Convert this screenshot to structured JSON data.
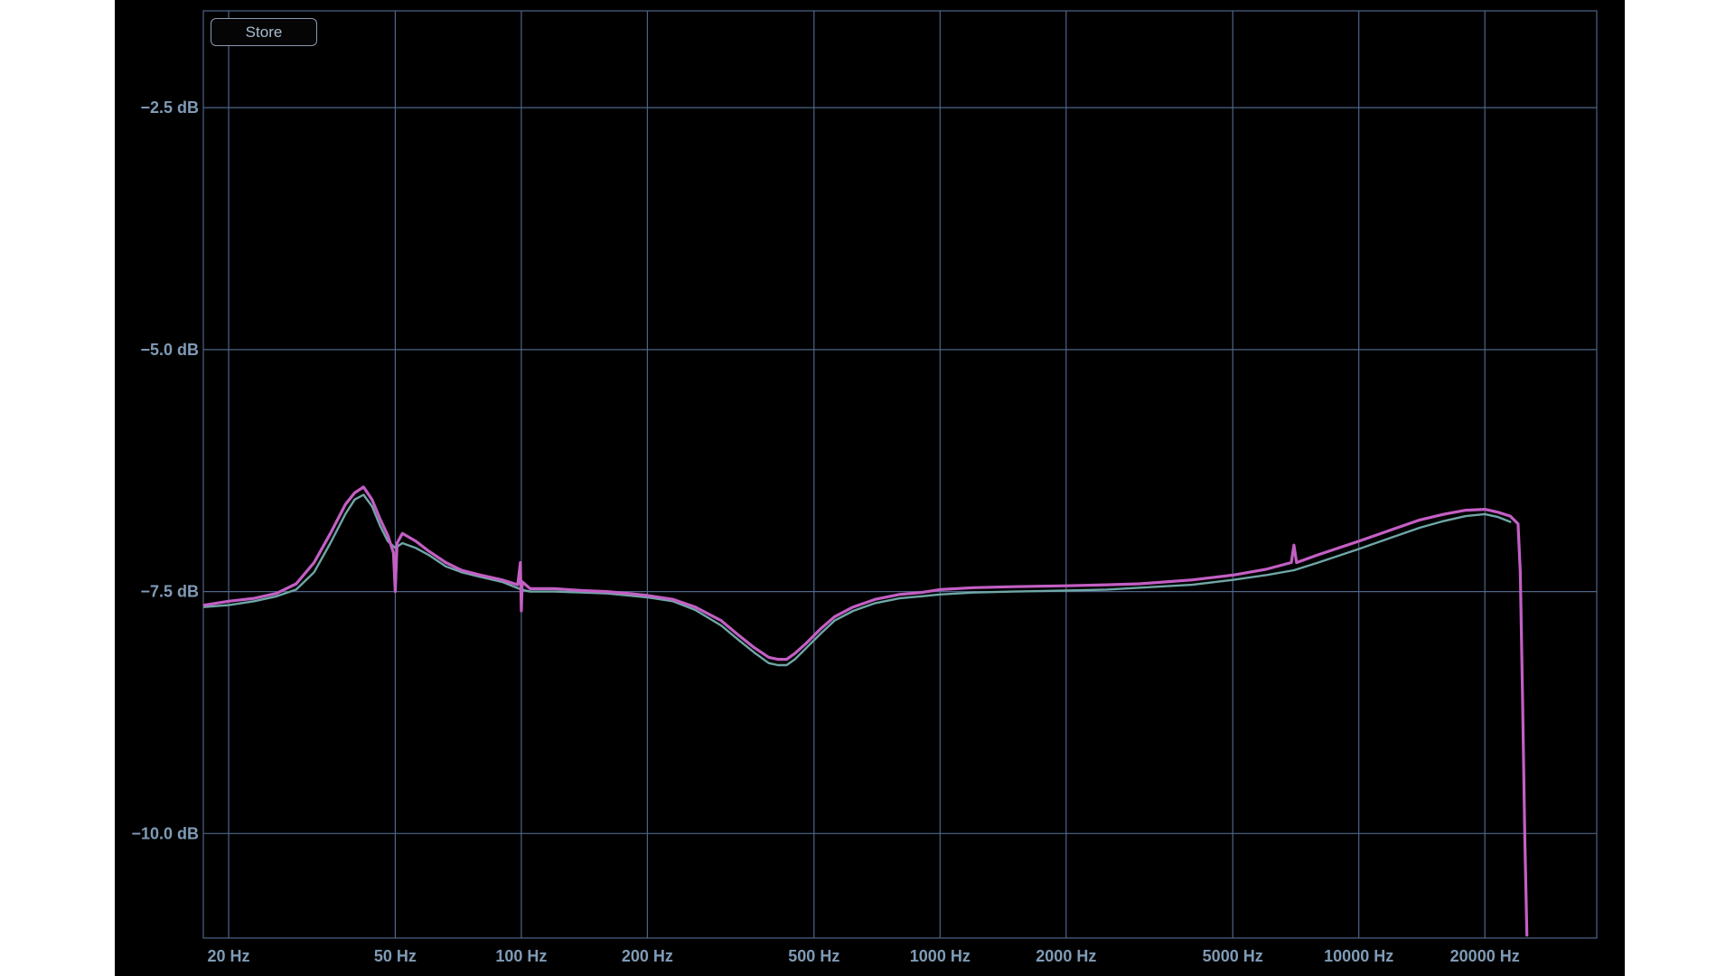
{
  "ui": {
    "store_label": "Store"
  },
  "colors": {
    "background": "#000000",
    "grid": "#4e6588",
    "tick_text": "#7f9bb6",
    "series_a": "#c35fc4",
    "series_b": "#6fa6a6"
  },
  "chart_data": {
    "type": "line",
    "title": "",
    "xlabel": "",
    "ylabel": "",
    "x_scale": "log",
    "x_ticks": [
      20,
      50,
      100,
      200,
      500,
      1000,
      2000,
      5000,
      10000,
      20000
    ],
    "x_tick_labels": [
      "20 Hz",
      "50 Hz",
      "100 Hz",
      "200 Hz",
      "500 Hz",
      "1000 Hz",
      "2000 Hz",
      "5000 Hz",
      "10000 Hz",
      "20000 Hz"
    ],
    "y_ticks": [
      -2.5,
      -5.0,
      -7.5,
      -10.0
    ],
    "y_tick_labels": [
      "-2.5 dB",
      "-5.0 dB",
      "-7.5 dB",
      "-10.0 dB"
    ],
    "xlim": [
      17.4,
      37000
    ],
    "ylim": [
      -11.08,
      -1.5
    ],
    "grid": true,
    "series": [
      {
        "color": "#c35fc4",
        "x": [
          17.5,
          20,
          23,
          26,
          29,
          32,
          35,
          38,
          40,
          42,
          44,
          46,
          48,
          49.5,
          50,
          50.5,
          52,
          56,
          60,
          66,
          72,
          80,
          90,
          98,
          99.5,
          100,
          100.5,
          105,
          120,
          140,
          160,
          180,
          200,
          230,
          260,
          300,
          330,
          360,
          390,
          410,
          430,
          450,
          480,
          520,
          560,
          620,
          700,
          800,
          900,
          1000,
          1200,
          1500,
          2000,
          2500,
          3000,
          4000,
          5000,
          6000,
          6900,
          7000,
          7100,
          8000,
          10000,
          12000,
          14000,
          16000,
          18000,
          20000,
          21500,
          23000,
          24000,
          24300,
          24600,
          24900,
          25200
        ],
        "y": [
          -7.64,
          -7.6,
          -7.57,
          -7.52,
          -7.42,
          -7.2,
          -6.9,
          -6.6,
          -6.48,
          -6.42,
          -6.55,
          -6.75,
          -6.92,
          -7.1,
          -7.5,
          -7.0,
          -6.9,
          -6.98,
          -7.08,
          -7.2,
          -7.28,
          -7.33,
          -7.38,
          -7.43,
          -7.2,
          -7.7,
          -7.4,
          -7.47,
          -7.47,
          -7.49,
          -7.5,
          -7.52,
          -7.54,
          -7.58,
          -7.66,
          -7.8,
          -7.95,
          -8.08,
          -8.18,
          -8.2,
          -8.2,
          -8.14,
          -8.03,
          -7.88,
          -7.76,
          -7.66,
          -7.58,
          -7.53,
          -7.51,
          -7.48,
          -7.46,
          -7.45,
          -7.44,
          -7.43,
          -7.42,
          -7.38,
          -7.33,
          -7.27,
          -7.2,
          -7.02,
          -7.2,
          -7.12,
          -6.98,
          -6.86,
          -6.76,
          -6.7,
          -6.66,
          -6.65,
          -6.68,
          -6.72,
          -6.8,
          -7.3,
          -8.6,
          -10.0,
          -11.05
        ]
      },
      {
        "color": "#6fa6a6",
        "x": [
          17.5,
          20,
          23,
          26,
          29,
          32,
          35,
          38,
          40,
          42,
          44,
          46,
          48,
          50,
          52,
          56,
          60,
          66,
          72,
          80,
          90,
          100,
          105,
          120,
          140,
          160,
          180,
          200,
          230,
          260,
          300,
          330,
          360,
          390,
          410,
          430,
          450,
          480,
          520,
          560,
          620,
          700,
          800,
          900,
          1000,
          1200,
          1500,
          2000,
          2500,
          3000,
          4000,
          5000,
          6000,
          7000,
          8000,
          10000,
          12000,
          14000,
          16000,
          18000,
          20000,
          21500,
          23000
        ],
        "y": [
          -7.66,
          -7.64,
          -7.6,
          -7.55,
          -7.48,
          -7.3,
          -7.0,
          -6.7,
          -6.55,
          -6.5,
          -6.62,
          -6.82,
          -6.98,
          -7.05,
          -7.0,
          -7.05,
          -7.12,
          -7.24,
          -7.3,
          -7.35,
          -7.4,
          -7.48,
          -7.5,
          -7.5,
          -7.51,
          -7.52,
          -7.54,
          -7.56,
          -7.6,
          -7.69,
          -7.85,
          -8.0,
          -8.13,
          -8.24,
          -8.26,
          -8.26,
          -8.2,
          -8.08,
          -7.93,
          -7.8,
          -7.7,
          -7.62,
          -7.57,
          -7.55,
          -7.53,
          -7.51,
          -7.5,
          -7.49,
          -7.48,
          -7.46,
          -7.43,
          -7.38,
          -7.33,
          -7.28,
          -7.2,
          -7.06,
          -6.94,
          -6.84,
          -6.77,
          -6.72,
          -6.7,
          -6.73,
          -6.78
        ]
      }
    ]
  }
}
